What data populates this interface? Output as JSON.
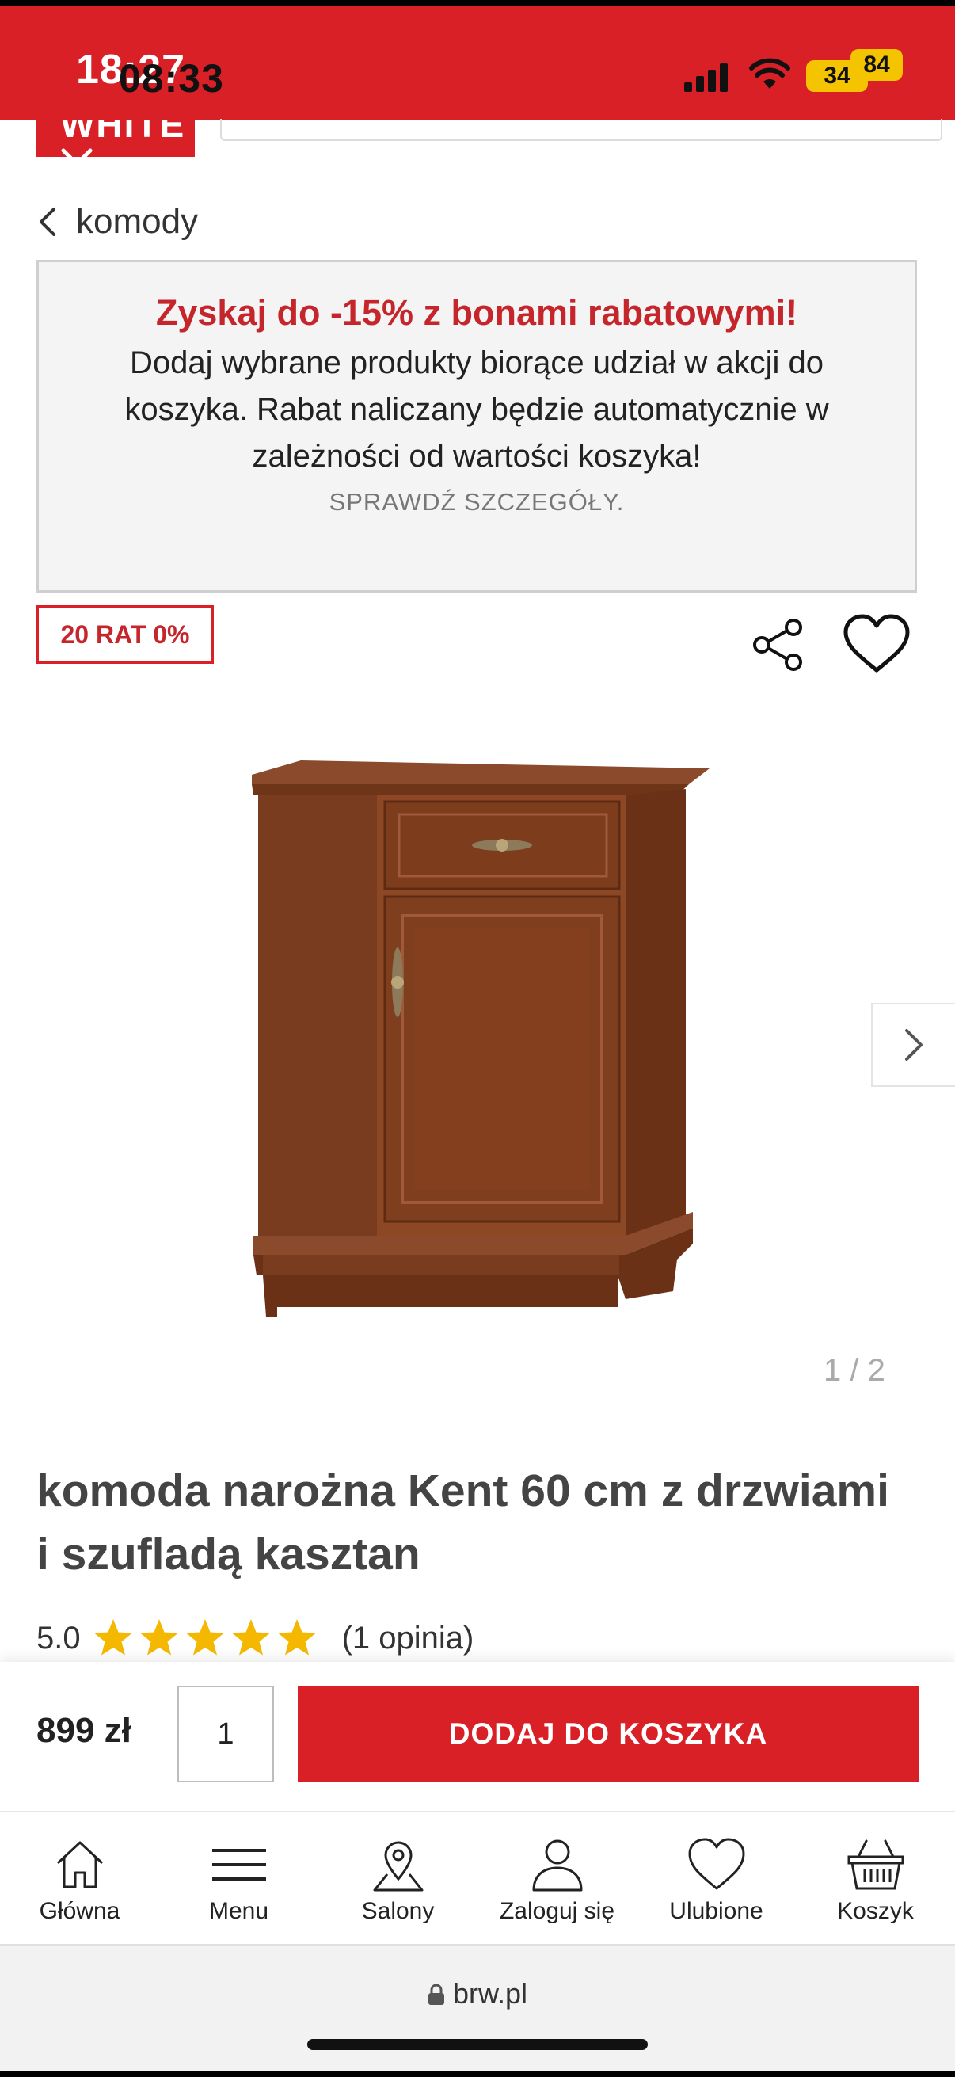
{
  "status_bar": {
    "time_back": "18:27",
    "time_front": "08:33",
    "battery_a": "34",
    "battery_b": "84"
  },
  "header": {
    "logo_text": "WHITE"
  },
  "breadcrumb": {
    "label": "komody"
  },
  "promo": {
    "title": "Zyskaj do -15% z bonami rabatowymi!",
    "body": "Dodaj wybrane produkty biorące udział w akcji do koszyka. Rabat naliczany będzie automatycznie w zależności od wartości koszyka!",
    "link": "SPRAWDŹ SZCZEGÓŁY."
  },
  "badge": {
    "label": "20 RAT 0%"
  },
  "gallery": {
    "pager": "1 / 2"
  },
  "product": {
    "title": "komoda narożna Kent 60 cm z drzwiami i szufladą kasztan",
    "rating_value": "5.0",
    "rating_stars": 5,
    "rating_count": "(1 opinia)"
  },
  "buy": {
    "price": "899 zł",
    "quantity": "1",
    "add_label": "DODAJ DO KOSZYKA"
  },
  "colors": {
    "brand_red": "#d92026",
    "star_yellow": "#f5b800"
  },
  "bottom_nav": {
    "items": [
      {
        "label": "Główna",
        "icon": "home-icon"
      },
      {
        "label": "Menu",
        "icon": "menu-icon"
      },
      {
        "label": "Salony",
        "icon": "map-pin-icon"
      },
      {
        "label": "Zaloguj się",
        "icon": "user-icon"
      },
      {
        "label": "Ulubione",
        "icon": "heart-icon"
      },
      {
        "label": "Koszyk",
        "icon": "basket-icon"
      }
    ]
  },
  "browser": {
    "url": "brw.pl"
  }
}
